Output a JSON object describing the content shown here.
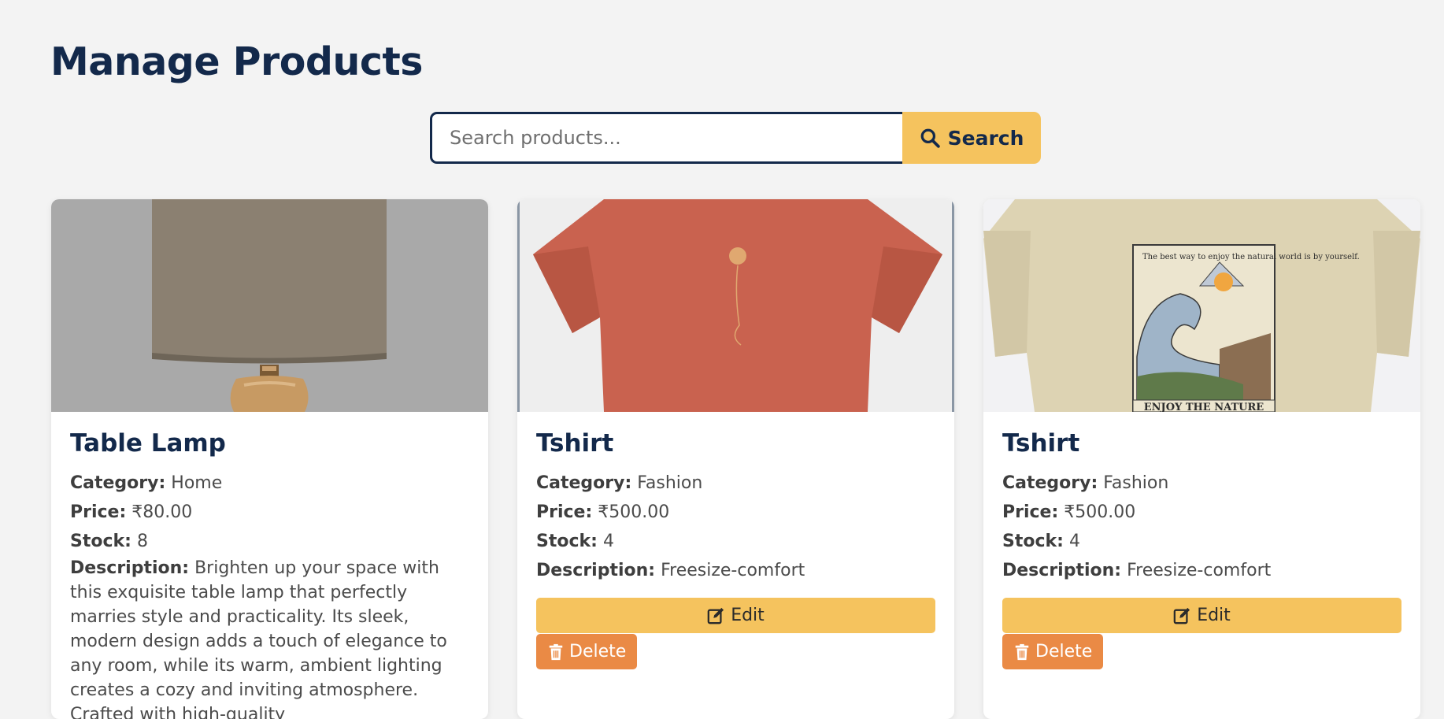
{
  "header": {
    "title": "Manage Products"
  },
  "search": {
    "placeholder": "Search products...",
    "button_label": "Search",
    "button_icon": "search-icon"
  },
  "colors": {
    "primary": "#13294b",
    "accent": "#f5c35e",
    "danger": "#ea8a45",
    "background": "#f3f3f3"
  },
  "products": [
    {
      "name": "Table Lamp",
      "category_label": "Category:",
      "category": "Home",
      "price_label": "Price:",
      "price": "₹80.00",
      "stock_label": "Stock:",
      "stock": "8",
      "description_label": "Description:",
      "description": "Brighten up your space with this exquisite table lamp that perfectly marries style and practicality. Its sleek, modern design adds a touch of elegance to any room, while its warm, ambient lighting creates a cozy and inviting atmosphere. Crafted with high-quality",
      "image": "table-lamp-image"
    },
    {
      "name": "Tshirt",
      "category_label": "Category:",
      "category": "Fashion",
      "price_label": "Price:",
      "price": "₹500.00",
      "stock_label": "Stock:",
      "stock": "4",
      "description_label": "Description:",
      "description": "Freesize-comfort",
      "edit_label": "Edit",
      "delete_label": "Delete",
      "image": "red-tshirt-image"
    },
    {
      "name": "Tshirt",
      "category_label": "Category:",
      "category": "Fashion",
      "price_label": "Price:",
      "price": "₹500.00",
      "stock_label": "Stock:",
      "stock": "4",
      "description_label": "Description:",
      "description": "Freesize-comfort",
      "edit_label": "Edit",
      "delete_label": "Delete",
      "image": "beige-tshirt-image",
      "image_text": {
        "slogan": "The best way to enjoy the natural world is by yourself.",
        "banner": "ENJOY THE NATURE"
      }
    }
  ]
}
